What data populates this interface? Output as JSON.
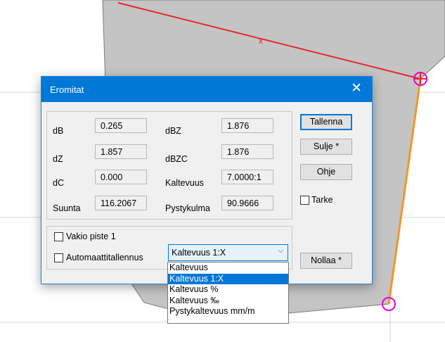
{
  "dialog": {
    "title": "Eromitat",
    "close_glyph": "✕"
  },
  "fields": {
    "dB": {
      "label": "dB",
      "value": "0.265"
    },
    "dZ": {
      "label": "dZ",
      "value": "1.857"
    },
    "dC": {
      "label": "dC",
      "value": "0.000"
    },
    "suunta": {
      "label": "Suunta",
      "value": "116.2067"
    },
    "dBZ": {
      "label": "dBZ",
      "value": "1.876"
    },
    "dBZC": {
      "label": "dBZC",
      "value": "1.876"
    },
    "kaltevuus": {
      "label": "Kaltevuus",
      "value": "7.0000:1"
    },
    "pystykulma": {
      "label": "Pystykulma",
      "value": "90.9666"
    }
  },
  "buttons": {
    "tallenna": "Tallenna",
    "sulje": "Sulje *",
    "ohje": "Ohje",
    "nollaa": "Nollaa *"
  },
  "checkboxes": {
    "tarke": "Tarke",
    "vakio": "Vakio piste 1",
    "automaatti": "Automaattitallennus"
  },
  "combo": {
    "selected": "Kaltevuus 1:X",
    "arrow": "⌵",
    "options": [
      "Kaltevuus",
      "Kaltevuus 1:X",
      "Kaltevuus %",
      "Kaltevuus ‰",
      "Pystykaltevuus mm/m"
    ],
    "selected_index": 1
  },
  "colors": {
    "accent": "#0078d7",
    "red_line": "#e8262b",
    "orange_line": "#f2962b",
    "marker": "#e400e4",
    "polygon": "#c4c4c4"
  }
}
